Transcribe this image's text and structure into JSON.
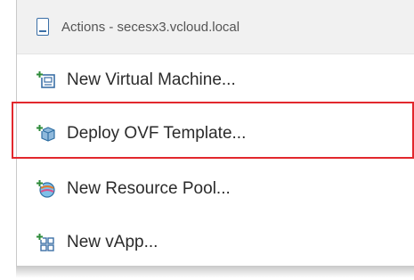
{
  "menu": {
    "header": {
      "title": "Actions - secesx3.vcloud.local",
      "icon": "host-icon"
    },
    "items": [
      {
        "label": "New Virtual Machine...",
        "icon": "new-vm-icon"
      },
      {
        "label": "Deploy OVF Template...",
        "icon": "deploy-ovf-icon",
        "highlighted": true
      },
      {
        "label": "New Resource Pool...",
        "icon": "resource-pool-icon"
      },
      {
        "label": "New vApp...",
        "icon": "vapp-icon"
      }
    ]
  },
  "colors": {
    "highlight_border": "#e2282d",
    "header_bg": "#f1f1f1",
    "icon_blue": "#3b6fa6"
  }
}
